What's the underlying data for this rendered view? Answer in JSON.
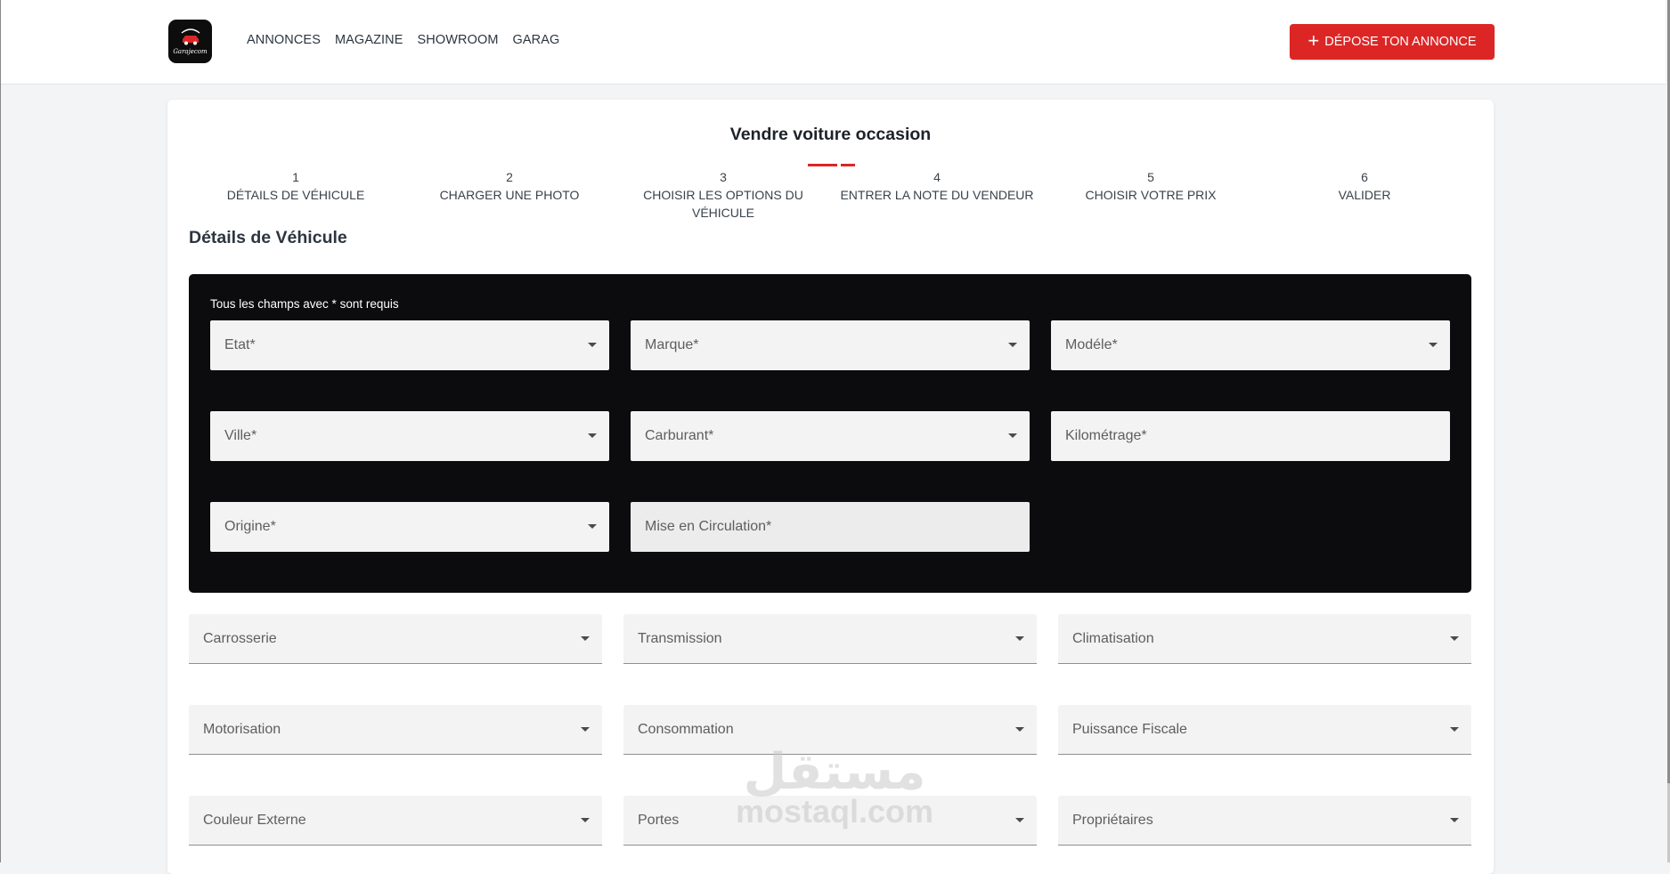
{
  "brand": {
    "logo_text": "Garajecom"
  },
  "nav": {
    "items": [
      {
        "label": "ANNONCES"
      },
      {
        "label": "MAGAZINE"
      },
      {
        "label": "SHOWROOM"
      },
      {
        "label": "GARAG"
      }
    ],
    "cta_label": "DÉPOSE TON ANNONCE"
  },
  "page": {
    "title": "Vendre voiture occasion",
    "section_title": "Détails de Véhicule",
    "required_note": "Tous les champs avec * sont requis"
  },
  "steps": [
    {
      "number": "1",
      "label": "DÉTAILS DE VÉHICULE"
    },
    {
      "number": "2",
      "label": "CHARGER UNE PHOTO"
    },
    {
      "number": "3",
      "label": "CHOISIR LES OPTIONS DU VÉHICULE"
    },
    {
      "number": "4",
      "label": "ENTRER LA NOTE DU VENDEUR"
    },
    {
      "number": "5",
      "label": "CHOISIR VOTRE PRIX"
    },
    {
      "number": "6",
      "label": "VALIDER"
    }
  ],
  "required_fields": {
    "etat": "Etat*",
    "marque": "Marque*",
    "modele": "Modéle*",
    "ville": "Ville*",
    "carburant": "Carburant*",
    "kilometrage": "Kilométrage*",
    "origine": "Origine*",
    "mise_en_circulation": "Mise en Circulation*"
  },
  "optional_fields": {
    "carrosserie": "Carrosserie",
    "transmission": "Transmission",
    "climatisation": "Climatisation",
    "motorisation": "Motorisation",
    "consommation": "Consommation",
    "puissance_fiscale": "Puissance Fiscale",
    "couleur_externe": "Couleur Externe",
    "portes": "Portes",
    "proprietaires": "Propriétaires"
  },
  "watermark": {
    "arabic": "مستقل",
    "latin": "mostaql.com"
  },
  "colors": {
    "accent": "#dc2626",
    "panel": "#0c0c0f",
    "field_bg": "#f3f3f3"
  }
}
